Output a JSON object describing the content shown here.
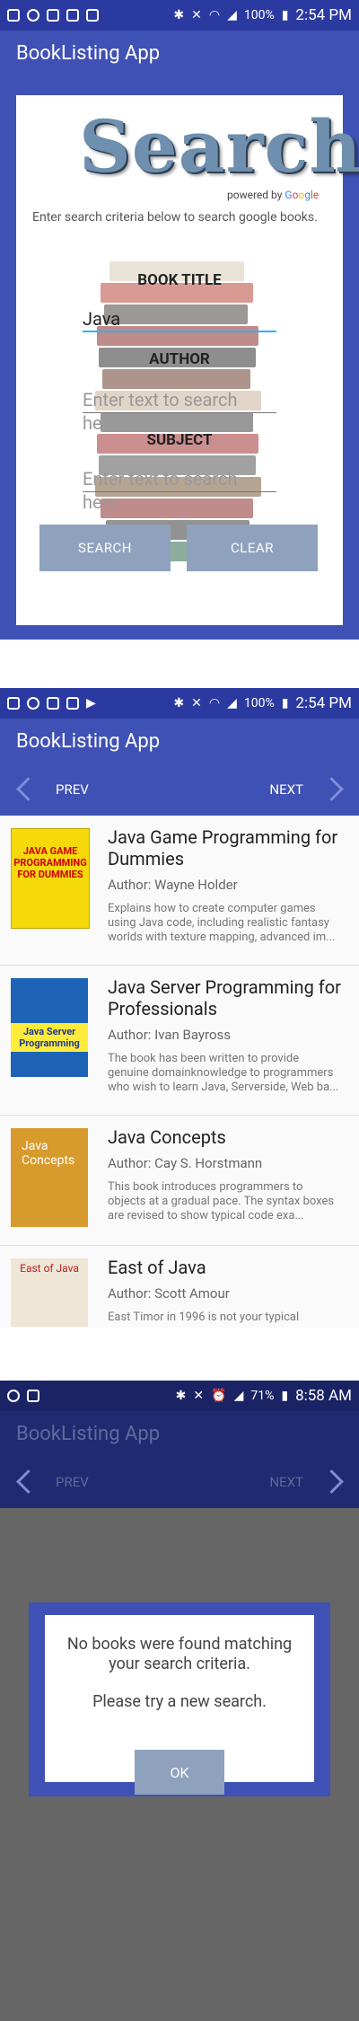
{
  "screen1": {
    "status": {
      "battery": "100%",
      "time": "2:54 PM"
    },
    "app_title": "BookListing App",
    "logo_text": "Search",
    "powered_prefix": "powered by",
    "google": [
      "G",
      "o",
      "o",
      "g",
      "l",
      "e"
    ],
    "description": "Enter search criteria below to search google books.",
    "labels": {
      "book_title": "BOOK TITLE",
      "author": "AUTHOR",
      "subject": "SUBJECT"
    },
    "inputs": {
      "book_title_value": "Java",
      "author_placeholder": "Enter text to search here",
      "subject_placeholder": "Enter text to search here"
    },
    "buttons": {
      "search": "SEARCH",
      "clear": "CLEAR"
    }
  },
  "screen2": {
    "status": {
      "battery": "100%",
      "time": "2:54 PM"
    },
    "app_title": "BookListing App",
    "nav": {
      "prev": "PREV",
      "next": "NEXT"
    },
    "books": [
      {
        "title": "Java Game Programming for Dummies",
        "author": "Author: Wayne Holder",
        "description": "Explains how to create computer games using Java code, including realistic fantasy worlds with texture mapping, advanced im...",
        "cover_text": "JAVA GAME PROGRAMMING FOR DUMMIES",
        "cover_color": "#f5d90a"
      },
      {
        "title": "Java Server Programming for Professionals",
        "author": "Author: Ivan Bayross",
        "description": "The book has been written to provide genuine domainknowledge to programmers who wish to learn Java, Serverside, Web ba...",
        "cover_text": "Java Server Programming",
        "cover_color": "#1e63b5"
      },
      {
        "title": "Java Concepts",
        "author": "Author: Cay S. Horstmann",
        "description": "This book introduces programmers to objects at a gradual pace. The syntax boxes are revised to show typical code exa...",
        "cover_text": "Java Concepts",
        "cover_color": "#d79a2c"
      },
      {
        "title": "East of Java",
        "author": "Author: Scott Amour",
        "description": "East Timor in 1996 is not your typical",
        "cover_text": "East of Java",
        "cover_color": "#efe6d8"
      }
    ]
  },
  "screen3": {
    "status": {
      "battery": "71%",
      "time": "8:58 AM"
    },
    "app_title": "BookListing App",
    "nav": {
      "prev": "PREV",
      "next": "NEXT"
    },
    "dialog": {
      "message": "No books were found matching your search criteria.",
      "hint": "Please try a new search.",
      "ok": "OK"
    }
  },
  "colors": {
    "primary": "#3f51b5",
    "button": "#8fa2bd",
    "dim": "#666666",
    "accent_line": "#29b6f6"
  }
}
